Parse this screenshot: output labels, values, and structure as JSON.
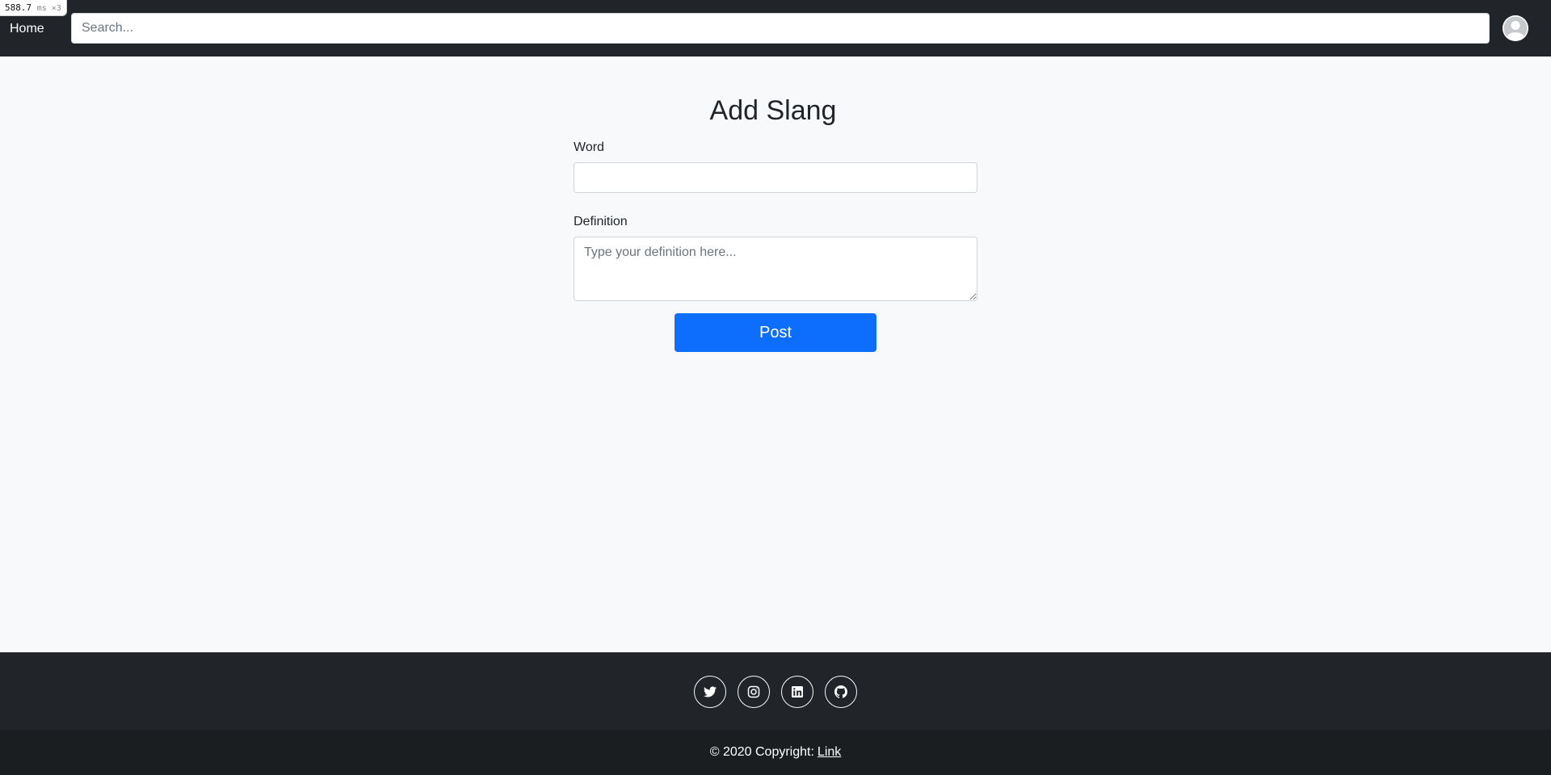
{
  "perf": {
    "value": "588.7",
    "unit": "ms ×3"
  },
  "navbar": {
    "home_label": "Home",
    "search_placeholder": "Search..."
  },
  "main": {
    "title": "Add Slang",
    "word_label": "Word",
    "word_value": "",
    "definition_label": "Definition",
    "definition_placeholder": "Type your definition here...",
    "post_label": "Post"
  },
  "footer": {
    "social": [
      {
        "icon": "twitter-icon"
      },
      {
        "icon": "instagram-icon"
      },
      {
        "icon": "linkedin-icon"
      },
      {
        "icon": "github-icon"
      }
    ],
    "copyright_text": "© 2020 Copyright:",
    "link_label": "Link"
  },
  "colors": {
    "navbar_bg": "#212529",
    "page_bg": "#f8f9fa",
    "primary": "#0d6efd",
    "footer_bottom_bg": "#1b1e21"
  }
}
